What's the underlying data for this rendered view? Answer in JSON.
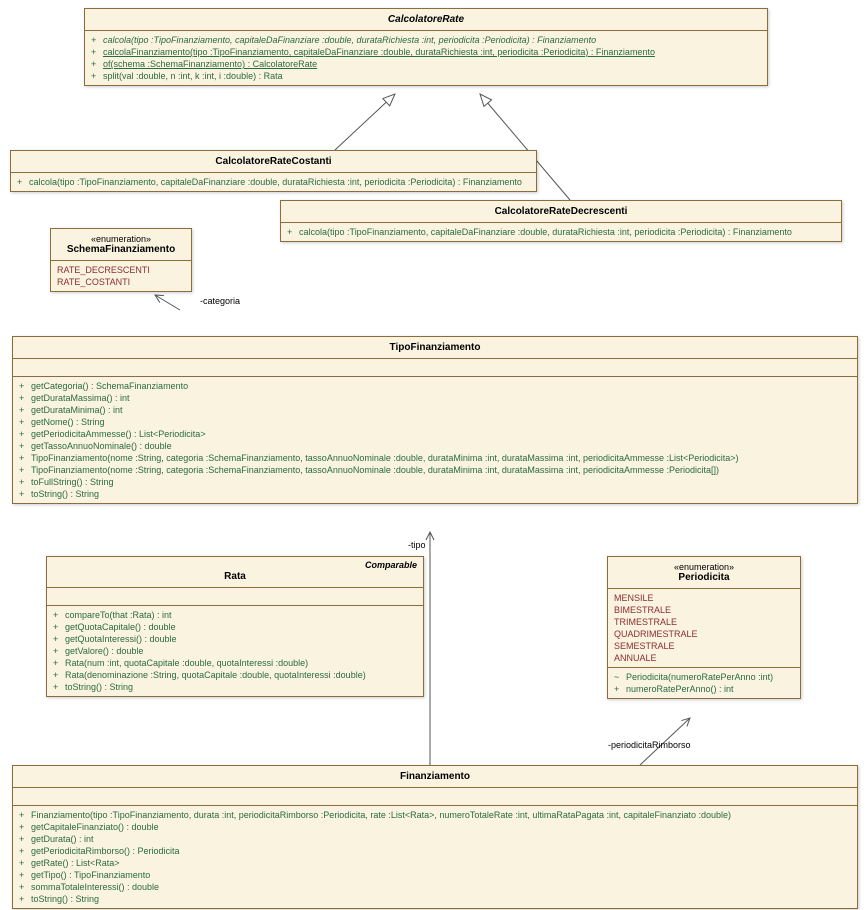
{
  "classes": {
    "calcolatoreRate": {
      "title": "CalcolatoreRate",
      "members": [
        {
          "vis": "+",
          "sig": "calcola(tipo :TipoFinanziamento, capitaleDaFinanziare :double, durataRichiesta :int, periodicita :Periodicita) : Finanziamento",
          "italic": true
        },
        {
          "vis": "+",
          "sig": "calcolaFinanziamento(tipo :TipoFinanziamento, capitaleDaFinanziare :double, durataRichiesta :int, periodicita :Periodicita) : Finanziamento",
          "underline": true
        },
        {
          "vis": "+",
          "sig": "of(schema :SchemaFinanziamento) : CalcolatoreRate",
          "underline": true
        },
        {
          "vis": "+",
          "sig": "split(val :double, n :int, k :int, i :double) : Rata"
        }
      ]
    },
    "calcolatoreRateCostanti": {
      "title": "CalcolatoreRateCostanti",
      "members": [
        {
          "vis": "+",
          "sig": "calcola(tipo :TipoFinanziamento, capitaleDaFinanziare :double, durataRichiesta :int, periodicita :Periodicita) : Finanziamento"
        }
      ]
    },
    "calcolatoreRateDecrescenti": {
      "title": "CalcolatoreRateDecrescenti",
      "members": [
        {
          "vis": "+",
          "sig": "calcola(tipo :TipoFinanziamento, capitaleDaFinanziare :double, durataRichiesta :int, periodicita :Periodicita) : Finanziamento"
        }
      ]
    },
    "schemaFinanziamento": {
      "stereotype": "«enumeration»",
      "title": "SchemaFinanziamento",
      "values": [
        "RATE_DECRESCENTI",
        "RATE_COSTANTI"
      ]
    },
    "tipoFinanziamento": {
      "title": "TipoFinanziamento",
      "members": [
        {
          "vis": "+",
          "sig": "getCategoria() : SchemaFinanziamento"
        },
        {
          "vis": "+",
          "sig": "getDurataMassima() : int"
        },
        {
          "vis": "+",
          "sig": "getDurataMinima() : int"
        },
        {
          "vis": "+",
          "sig": "getNome() : String"
        },
        {
          "vis": "+",
          "sig": "getPeriodicitaAmmesse() : List<Periodicita>"
        },
        {
          "vis": "+",
          "sig": "getTassoAnnuoNominale() : double"
        },
        {
          "vis": "+",
          "sig": "TipoFinanziamento(nome :String, categoria :SchemaFinanziamento, tassoAnnuoNominale :double, durataMinima :int, durataMassima :int, periodicitaAmmesse :List<Periodicita>)"
        },
        {
          "vis": "+",
          "sig": "TipoFinanziamento(nome :String, categoria :SchemaFinanziamento, tassoAnnuoNominale :double, durataMinima :int, durataMassima :int, periodicitaAmmesse :Periodicita[])"
        },
        {
          "vis": "+",
          "sig": "toFullString() : String"
        },
        {
          "vis": "+",
          "sig": "toString() : String"
        }
      ]
    },
    "rata": {
      "title": "Rata",
      "interface": "Comparable",
      "members": [
        {
          "vis": "+",
          "sig": "compareTo(that :Rata) : int"
        },
        {
          "vis": "+",
          "sig": "getQuotaCapitale() : double"
        },
        {
          "vis": "+",
          "sig": "getQuotaInteressi() : double"
        },
        {
          "vis": "+",
          "sig": "getValore() : double"
        },
        {
          "vis": "+",
          "sig": "Rata(num :int, quotaCapitale :double, quotaInteressi :double)"
        },
        {
          "vis": "+",
          "sig": "Rata(denominazione :String, quotaCapitale :double, quotaInteressi :double)"
        },
        {
          "vis": "+",
          "sig": "toString() : String"
        }
      ]
    },
    "periodicita": {
      "stereotype": "«enumeration»",
      "title": "Periodicita",
      "values": [
        "MENSILE",
        "BIMESTRALE",
        "TRIMESTRALE",
        "QUADRIMESTRALE",
        "SEMESTRALE",
        "ANNUALE"
      ],
      "members": [
        {
          "vis": "~",
          "sig": "Periodicita(numeroRatePerAnno :int)"
        },
        {
          "vis": "+",
          "sig": "numeroRatePerAnno() : int"
        }
      ]
    },
    "finanziamento": {
      "title": "Finanziamento",
      "members": [
        {
          "vis": "+",
          "sig": "Finanziamento(tipo :TipoFinanziamento, durata :int, periodicitaRimborso :Periodicita, rate :List<Rata>, numeroTotaleRate :int, ultimaRataPagata :int, capitaleFinanziato :double)"
        },
        {
          "vis": "+",
          "sig": "getCapitaleFinanziato() : double"
        },
        {
          "vis": "+",
          "sig": "getDurata() : int"
        },
        {
          "vis": "+",
          "sig": "getPeriodicitaRimborso() : Periodicita"
        },
        {
          "vis": "+",
          "sig": "getRate() : List<Rata>"
        },
        {
          "vis": "+",
          "sig": "getTipo() : TipoFinanziamento"
        },
        {
          "vis": "+",
          "sig": "sommaTotaleInteressi() : double"
        },
        {
          "vis": "+",
          "sig": "toString() : String"
        }
      ]
    }
  },
  "labels": {
    "categoria": "-categoria",
    "tipo": "-tipo",
    "periodicitaRimborso": "-periodicitaRimborso"
  }
}
